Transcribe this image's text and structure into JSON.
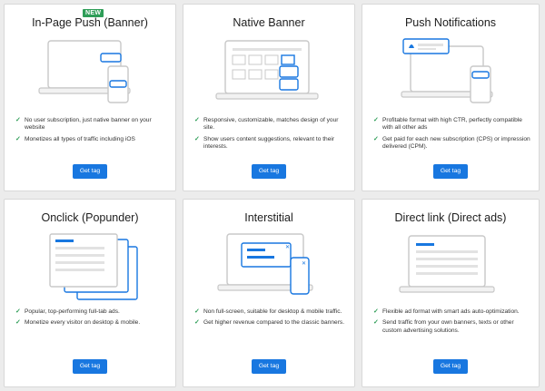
{
  "cards": [
    {
      "title": "In-Page Push (Banner)",
      "badge": "NEW",
      "features": [
        "No user subscription, just native banner on your website",
        "Monetizes all types of traffic including iOS"
      ],
      "button": "Get tag"
    },
    {
      "title": "Native Banner",
      "features": [
        "Responsive, customizable, matches design of your site.",
        "Show users content suggestions, relevant to their interests."
      ],
      "button": "Get tag"
    },
    {
      "title": "Push Notifications",
      "features": [
        "Profitable format with high CTR, perfectly compatible with all other ads",
        "Get paid for each new subscription (CPS) or impression delivered (CPM)."
      ],
      "button": "Get tag"
    },
    {
      "title": "Onclick (Popunder)",
      "features": [
        "Popular, top-performing full-tab ads.",
        "Monetize every visitor on desktop & mobile."
      ],
      "button": "Get tag"
    },
    {
      "title": "Interstitial",
      "features": [
        "Non full-screen, suitable for desktop & mobile traffic.",
        "Get higher revenue compared to the classic banners."
      ],
      "button": "Get tag"
    },
    {
      "title": "Direct link (Direct ads)",
      "features": [
        "Flexible ad format with smart ads auto-optimization.",
        "Send traffic from your own banners, texts or other custom advertising solutions."
      ],
      "button": "Get tag"
    }
  ],
  "colors": {
    "accent": "#1877e0",
    "check": "#2e9d57",
    "badge": "#2e9d57",
    "outline": "#c8c8c8",
    "highlight": "#1877e0"
  },
  "icons": {
    "check": "check-icon"
  }
}
